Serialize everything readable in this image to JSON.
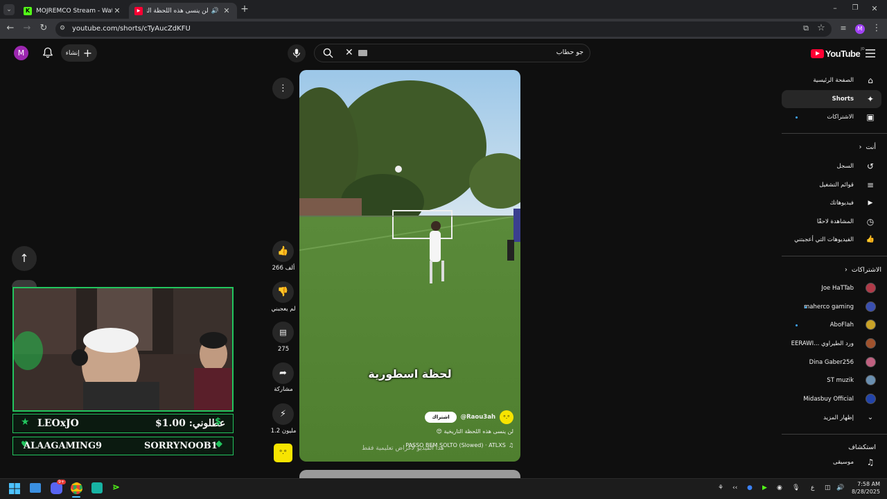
{
  "browser": {
    "tabs": [
      {
        "title": "MOJREMCO Stream - Watch Li",
        "favicon": "K"
      },
      {
        "title": "لن ينسى هذه اللحظة التاريخية",
        "favicon": "▶"
      }
    ],
    "url": "youtube.com/shorts/cTyAucZdKFU",
    "profile_initial": "M"
  },
  "youtube": {
    "logo_text": "YouTube",
    "logo_badge": "JO",
    "search_value": "جو حطاب",
    "create_label": "إنشاء",
    "account_initial": "M"
  },
  "sidebar": {
    "main": [
      {
        "label": "الصفحة الرئيسية",
        "icon": "home-icon",
        "glyph": "⌂"
      },
      {
        "label": "Shorts",
        "icon": "shorts-icon",
        "glyph": "✦"
      },
      {
        "label": "الاشتراكات",
        "icon": "subscriptions-icon",
        "glyph": "▣"
      }
    ],
    "you_header": "أنت",
    "you": [
      {
        "label": "السجل",
        "icon": "history-icon",
        "glyph": "↺"
      },
      {
        "label": "قوائم التشغيل",
        "icon": "playlists-icon",
        "glyph": "≡"
      },
      {
        "label": "فيديوهاتك",
        "icon": "your-videos-icon",
        "glyph": "▶"
      },
      {
        "label": "المشاهدة لاحقًا",
        "icon": "watch-later-icon",
        "glyph": "◷"
      },
      {
        "label": "الفيديوهات التي أعجبتني",
        "icon": "liked-icon",
        "glyph": "👍"
      }
    ],
    "subs_header": "الاشتراكات",
    "subscriptions": [
      {
        "label": "Joe HaTTab",
        "color": "#b03a48",
        "live": false
      },
      {
        "label": "maherco gaming",
        "color": "#3a4fb0",
        "live": true
      },
      {
        "label": "AboFlah",
        "color": "#c9a227",
        "live": true
      },
      {
        "label": "EERAWI... ورد الطيراوي",
        "color": "#a0522d",
        "live": false
      },
      {
        "label": "Dina Gaber256",
        "color": "#c06080",
        "live": false
      },
      {
        "label": "ST muzik",
        "color": "#6a8fb0",
        "live": false
      },
      {
        "label": "Midasbuy Official",
        "color": "#2244aa",
        "live": false
      }
    ],
    "show_more": "إظهار المزيد",
    "explore_header": "استكشاف",
    "explore": [
      {
        "label": "موسيقى",
        "icon": "music-icon",
        "glyph": "♫"
      }
    ]
  },
  "short": {
    "caption_overlay": "لحظة اسطورية",
    "channel_handle": "@Raou3ah",
    "subscribe_label": "اشتراك",
    "title": "لن ينسى هذه اللحظة التاريخية 😍",
    "music": "PASSO BEM SOLTO (Slowed) · ATLXS",
    "disclaimer": "هذا الفيديو لأغراض تعليمية فقط"
  },
  "actions": {
    "likes": "266 ألف",
    "dislike_label": "لم يعجبني",
    "comments": "275",
    "share_label": "مشاركة",
    "remix": "1.2 مليون"
  },
  "stream_overlay": {
    "name1": "LEOxJO",
    "donate": "عطلوني: 1.00$",
    "name2": "ALAAGAMING9",
    "name3": "SORRYNOOB1"
  },
  "taskbar": {
    "time": "7:58 AM",
    "date": "8/28/2025",
    "lang": "ع",
    "discord_badge": "9+"
  }
}
